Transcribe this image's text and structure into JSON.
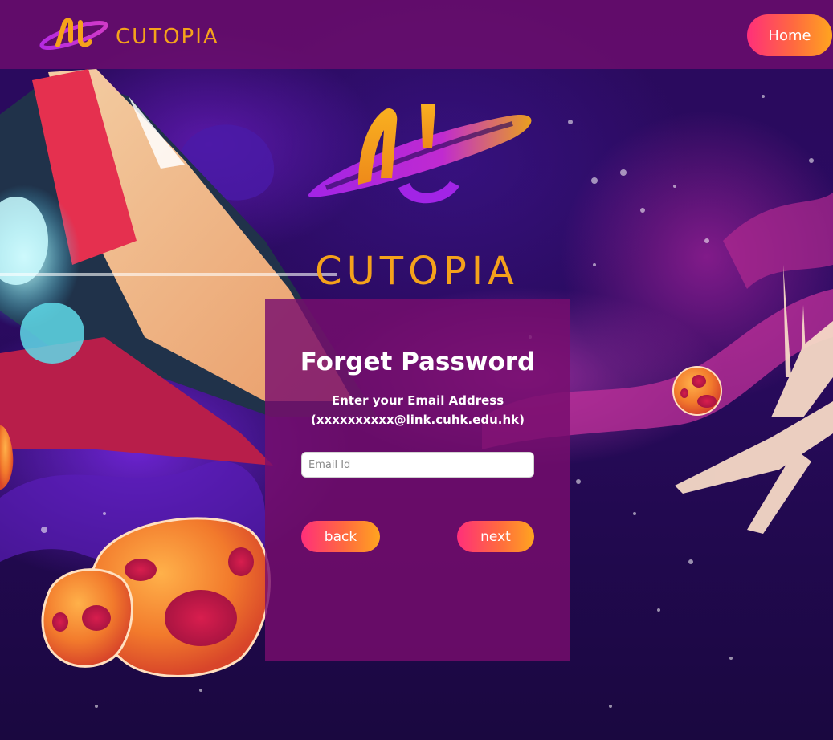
{
  "nav": {
    "logo_text": "CUTOPIA",
    "home_label": "Home"
  },
  "hero": {
    "logo_text": "CUTOPIA"
  },
  "form": {
    "title": "Forget Password",
    "subtitle_line1": "Enter your Email Address",
    "subtitle_line2": "(xxxxxxxxxx@link.cuhk.edu.hk)",
    "email_placeholder": "Email Id",
    "email_value": "",
    "back_label": "back",
    "next_label": "next"
  },
  "colors": {
    "brand_orange": "#f5a21b",
    "brand_purple": "#b62ae0",
    "button_gradient_start": "#ff2f7a",
    "button_gradient_end": "#ffa51f",
    "card_background": "#780e6e",
    "nav_background": "#6e0e6e"
  }
}
